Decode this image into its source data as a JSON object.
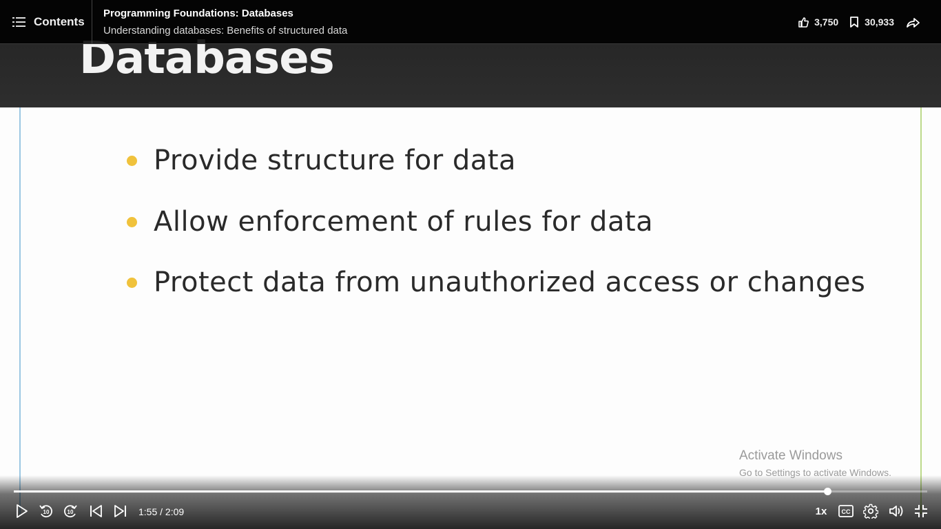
{
  "topbar": {
    "contents_label": "Contents",
    "course_title": "Programming Foundations: Databases",
    "video_title": "Understanding databases: Benefits of structured data",
    "likes": "3,750",
    "saves": "30,933"
  },
  "slide": {
    "title": "Databases",
    "bullets": [
      "Provide structure for data",
      "Allow enforcement of rules for data",
      "Protect data from unauthorized access or changes"
    ],
    "bullet_color": "#f0c23c"
  },
  "watermark": {
    "line1": "Activate Windows",
    "line2": "Go to Settings to activate Windows."
  },
  "player": {
    "time": "1:55 / 2:09",
    "progress": 0.891,
    "speed": "1x",
    "icons": [
      "play-icon",
      "rewind-10-icon",
      "forward-10-icon",
      "previous-icon",
      "next-icon",
      "captions-icon",
      "settings-icon",
      "volume-icon",
      "exit-fullscreen-icon"
    ]
  }
}
